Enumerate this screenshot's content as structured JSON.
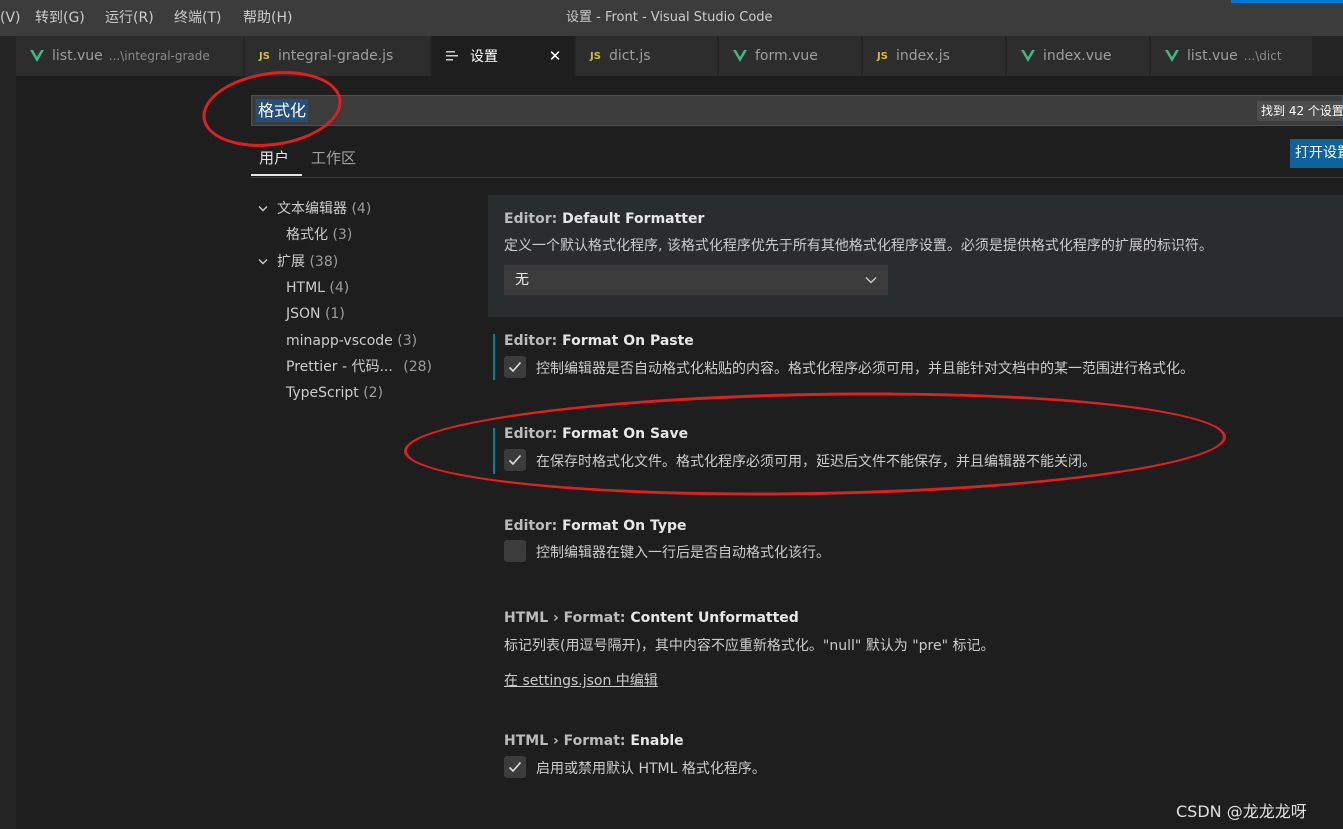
{
  "window": {
    "title": "设置 - Front - Visual Studio Code",
    "accent_color": "#0078d4"
  },
  "menu": {
    "items": [
      "(V)",
      "转到(G)",
      "运行(R)",
      "终端(T)",
      "帮助(H)"
    ]
  },
  "tabs": [
    {
      "label": "list.vue",
      "desc": "...\\integral-grade",
      "icon": "vue-icon"
    },
    {
      "label": "integral-grade.js",
      "desc": "",
      "icon": "js-icon"
    },
    {
      "label": "设置",
      "desc": "",
      "icon": "settings-editor-icon",
      "active": true
    },
    {
      "label": "dict.js",
      "desc": "",
      "icon": "js-icon"
    },
    {
      "label": "form.vue",
      "desc": "",
      "icon": "vue-icon"
    },
    {
      "label": "index.js",
      "desc": "",
      "icon": "js-icon"
    },
    {
      "label": "index.vue",
      "desc": "",
      "icon": "vue-icon"
    },
    {
      "label": "list.vue",
      "desc": "...\\dict",
      "icon": "vue-icon"
    }
  ],
  "icons": {
    "js": "JS",
    "close": "✕"
  },
  "search": {
    "value": "格式化",
    "result_count": "找到 42 个设置"
  },
  "scopes": {
    "user": "用户",
    "workspace": "工作区",
    "open_json": "打开设置"
  },
  "toc": [
    {
      "label": "文本编辑器",
      "count": "(4)",
      "expanded": true
    },
    {
      "label": "格式化",
      "count": "(3)"
    },
    {
      "label": "扩展",
      "count": "(38)",
      "expanded": true
    },
    {
      "label": "HTML",
      "count": "(4)"
    },
    {
      "label": "JSON",
      "count": "(1)"
    },
    {
      "label": "minapp-vscode",
      "count": "(3)"
    },
    {
      "label": "Prettier - 代码...",
      "count": "(28)"
    },
    {
      "label": "TypeScript",
      "count": "(2)"
    }
  ],
  "settings": [
    {
      "category": "Editor: ",
      "key": "Default Formatter",
      "desc": "定义一个默认格式化程序, 该格式化程序优先于所有其他格式化程序设置。必须是提供格式化程序的扩展的标识符。",
      "value": "无"
    },
    {
      "category": "Editor: ",
      "key": "Format On Paste",
      "desc": "控制编辑器是否自动格式化粘贴的内容。格式化程序必须可用，并且能针对文档中的某一范围进行格式化。",
      "checked": true
    },
    {
      "category": "Editor: ",
      "key": "Format On Save",
      "desc": "在保存时格式化文件。格式化程序必须可用，延迟后文件不能保存，并且编辑器不能关闭。",
      "checked": true
    },
    {
      "category": "Editor: ",
      "key": "Format On Type",
      "desc": "控制编辑器在键入一行后是否自动格式化该行。",
      "checked": false
    },
    {
      "category": "HTML › Format: ",
      "key": "Content Unformatted",
      "desc": "标记列表(用逗号隔开)，其中内容不应重新格式化。\"null\" 默认为 \"pre\" 标记。",
      "link": "在 settings.json 中编辑"
    },
    {
      "category": "HTML › Format: ",
      "key": "Enable",
      "desc": "启用或禁用默认 HTML 格式化程序。",
      "checked": true
    }
  ],
  "watermark": "CSDN @龙龙龙呀",
  "colors": {
    "annotation_red": "#e02020",
    "modified_indicator": "#0c7d9d",
    "vue_green": "#41b883",
    "js_yellow": "#d7ba3d"
  }
}
